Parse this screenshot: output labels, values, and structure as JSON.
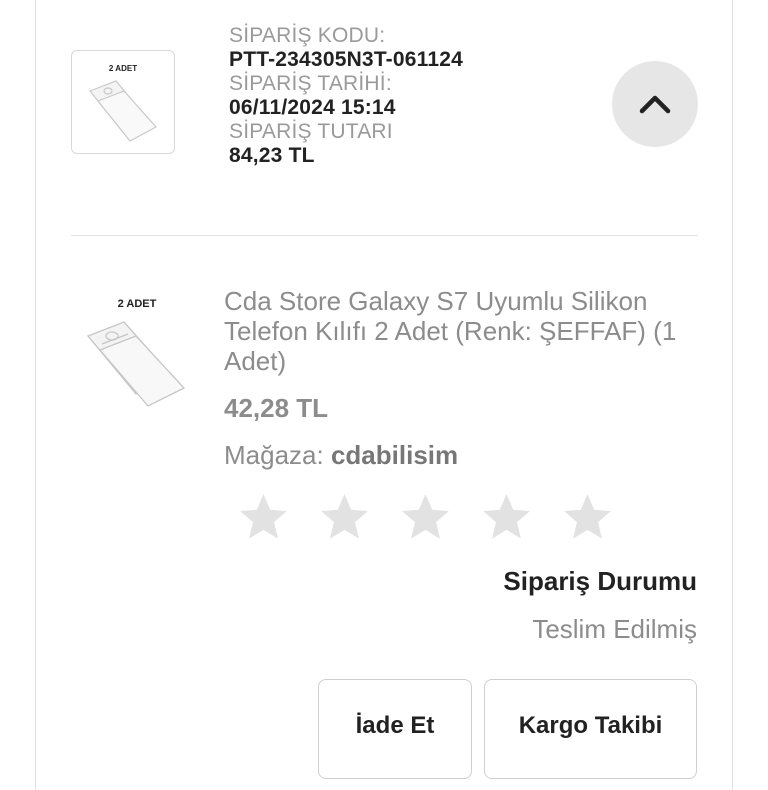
{
  "order": {
    "code_label": "SİPARİŞ KODU:",
    "code_value": "PTT-234305N3T-061124",
    "date_label": "SİPARİŞ TARİHİ:",
    "date_value": "06/11/2024 15:14",
    "total_label": "SİPARİŞ TUTARI",
    "total_value": "84,23 TL",
    "thumb_badge": "2 ADET",
    "collapse_icon": "chevron-up-icon"
  },
  "product": {
    "image_badge": "2 ADET",
    "title": "Cda Store Galaxy S7 Uyumlu Silikon Telefon Kılıfı 2 Adet (Renk: ŞEFFAF) (1 Adet)",
    "price": "42,28 TL",
    "store_label": "Mağaza:",
    "store_name": "cdabilisim",
    "rating": {
      "max": 5,
      "value": 0
    }
  },
  "status": {
    "title": "Sipariş Durumu",
    "value": "Teslim Edilmiş"
  },
  "actions": {
    "return_label": "İade Et",
    "cargo_label": "Kargo Takibi"
  },
  "colors": {
    "star_empty": "#e2e2e2",
    "collapse_bg": "#e6e6e6"
  }
}
